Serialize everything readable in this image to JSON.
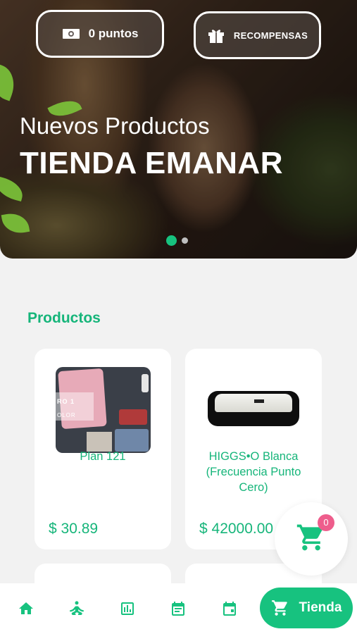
{
  "hero": {
    "points_label": "0 puntos",
    "rewards_label": "RECOMPENSAS",
    "subtitle": "Nuevos Productos",
    "title": "TIENDA EMANAR",
    "carousel": {
      "count": 2,
      "active_index": 0
    }
  },
  "section_title": "Productos",
  "products": [
    {
      "name": "Plan 121",
      "price": "$ 30.89",
      "image": "clothing-photo",
      "image_text": [
        "RO 1",
        "OLOR"
      ]
    },
    {
      "name": "HIGGS•O Blanca (Frecuencia Punto Cero)",
      "price": "$ 42000.00",
      "image": "device-photo"
    }
  ],
  "cart": {
    "count": "0"
  },
  "nav": {
    "items": [
      "home-icon",
      "meditation-icon",
      "chart-icon",
      "calendar-icon",
      "calendar-event-icon"
    ],
    "store_label": "Tienda"
  },
  "colors": {
    "accent": "#17c27f",
    "text_accent": "#16b57a",
    "badge": "#ee5d8c"
  }
}
